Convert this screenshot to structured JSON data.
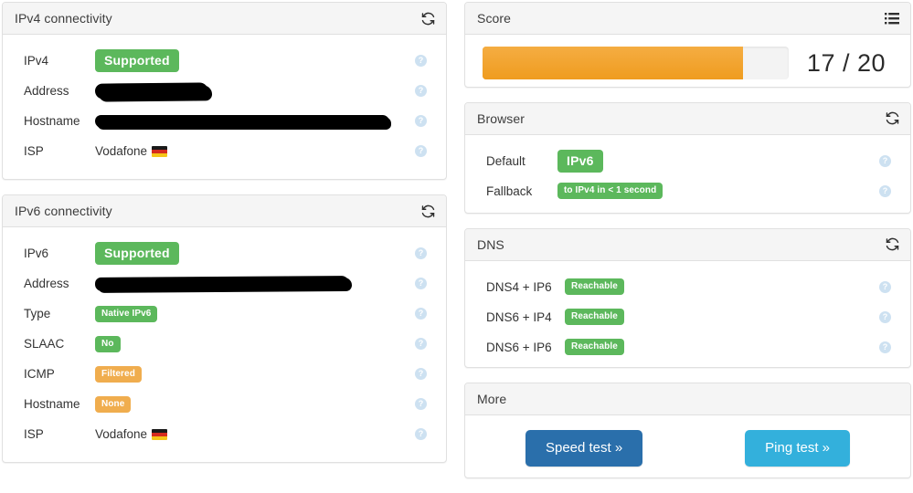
{
  "colors": {
    "green": "#5cb85c",
    "orange": "#f0ad4e",
    "progress_fill": "#f0a030",
    "btn_primary": "#2a6fab",
    "btn_info": "#33b0dc",
    "help_icon": "#c5dcef"
  },
  "panels": {
    "ipv4": {
      "title": "IPv4 connectivity",
      "refresh_icon": "refresh-icon",
      "rows": [
        {
          "label": "IPv4",
          "kind": "badge",
          "value": "Supported",
          "style": "green",
          "size": "big",
          "help": "?"
        },
        {
          "label": "Address",
          "kind": "redact",
          "value": "",
          "redact": "short",
          "help": "?"
        },
        {
          "label": "Hostname",
          "kind": "redact",
          "value": "",
          "redact": "long",
          "help": "?"
        },
        {
          "label": "ISP",
          "kind": "text",
          "value": "Vodafone",
          "flag": "de",
          "help": "?"
        }
      ]
    },
    "ipv6": {
      "title": "IPv6 connectivity",
      "refresh_icon": "refresh-icon",
      "rows": [
        {
          "label": "IPv6",
          "kind": "badge",
          "value": "Supported",
          "style": "green",
          "size": "big",
          "help": "?"
        },
        {
          "label": "Address",
          "kind": "redact",
          "value": "",
          "redact": "med",
          "help": "?"
        },
        {
          "label": "Type",
          "kind": "badge",
          "value": "Native IPv6",
          "style": "green",
          "size": "sm",
          "help": "?"
        },
        {
          "label": "SLAAC",
          "kind": "badge",
          "value": "No",
          "style": "green",
          "size": "sm",
          "help": "?"
        },
        {
          "label": "ICMP",
          "kind": "badge",
          "value": "Filtered",
          "style": "orange",
          "size": "sm",
          "help": "?"
        },
        {
          "label": "Hostname",
          "kind": "badge",
          "value": "None",
          "style": "orange",
          "size": "sm",
          "help": "?"
        },
        {
          "label": "ISP",
          "kind": "text",
          "value": "Vodafone",
          "flag": "de",
          "help": "?"
        }
      ]
    },
    "score": {
      "title": "Score",
      "list_icon": "list-icon",
      "value": 17,
      "max": 20,
      "display": "17 / 20",
      "percent": 85
    },
    "browser": {
      "title": "Browser",
      "refresh_icon": "refresh-icon",
      "rows": [
        {
          "label": "Default",
          "kind": "badge",
          "value": "IPv6",
          "style": "green",
          "size": "big",
          "help": "?"
        },
        {
          "label": "Fallback",
          "kind": "badge",
          "value": "to IPv4 in < 1 second",
          "style": "green",
          "size": "sm",
          "help": "?"
        }
      ]
    },
    "dns": {
      "title": "DNS",
      "refresh_icon": "refresh-icon",
      "rows": [
        {
          "label": "DNS4 + IP6",
          "kind": "badge",
          "value": "Reachable",
          "style": "green",
          "size": "sm",
          "help": "?"
        },
        {
          "label": "DNS6 + IP4",
          "kind": "badge",
          "value": "Reachable",
          "style": "green",
          "size": "sm",
          "help": "?"
        },
        {
          "label": "DNS6 + IP6",
          "kind": "badge",
          "value": "Reachable",
          "style": "green",
          "size": "sm",
          "help": "?"
        }
      ]
    },
    "more": {
      "title": "More",
      "speed_test_label": "Speed test »",
      "ping_test_label": "Ping test »"
    }
  }
}
